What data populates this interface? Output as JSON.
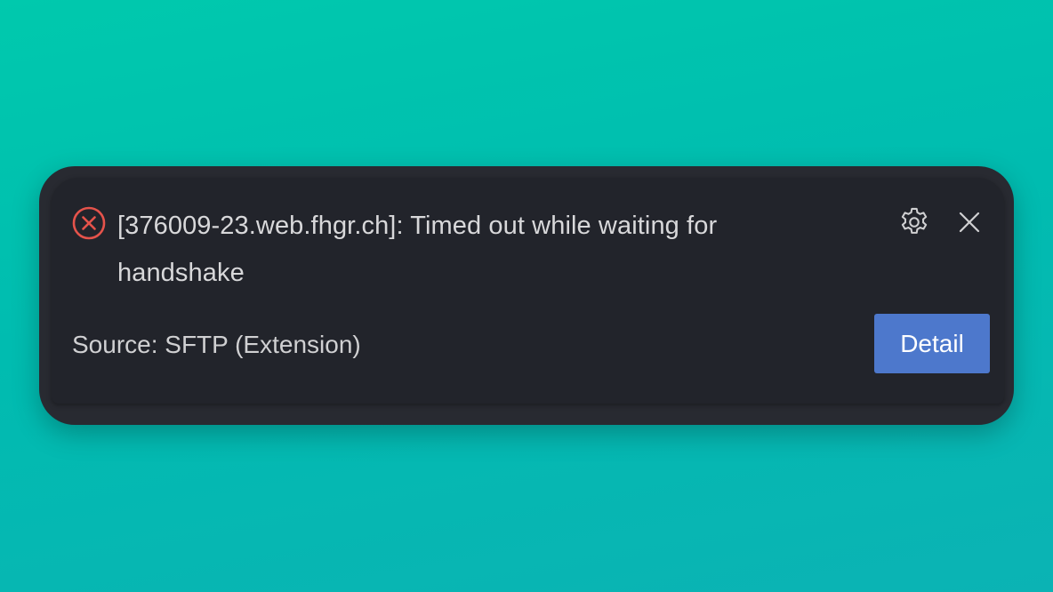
{
  "notification": {
    "severity_icon": "error-circle-x-icon",
    "message": "[376009-23.web.fhgr.ch]: Timed out while waiting for handshake",
    "source": "Source: SFTP (Extension)",
    "detail_label": "Detail",
    "settings_icon": "gear-icon",
    "close_icon": "close-icon"
  },
  "colors": {
    "background_top": "#00c9ad",
    "background_bottom": "#0bb3b4",
    "toast_background": "#22242b",
    "error_red": "#e5534b",
    "button_blue": "#4d78cc",
    "text": "#d8d8da"
  }
}
